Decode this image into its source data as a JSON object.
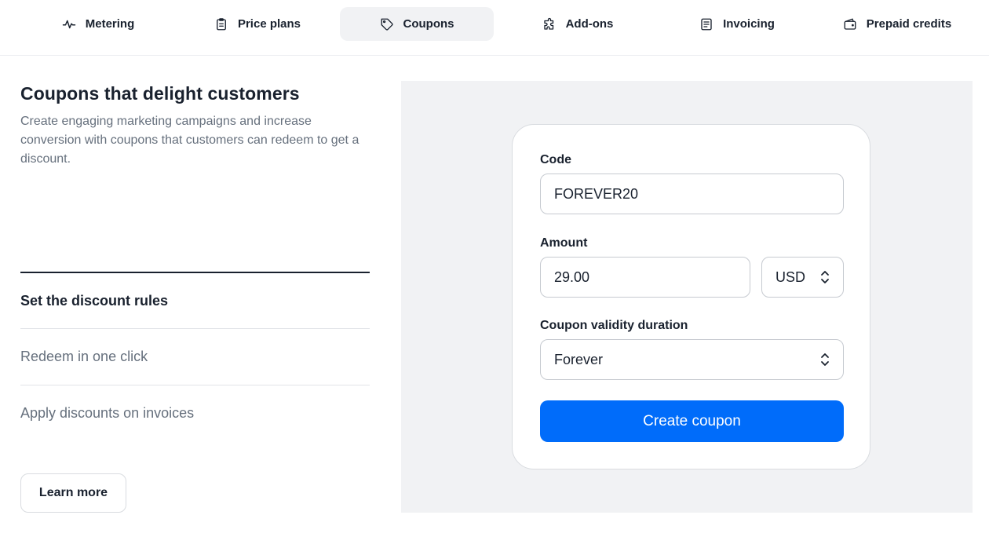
{
  "tabs": [
    {
      "label": "Metering",
      "icon": "pulse-icon",
      "active": false
    },
    {
      "label": "Price plans",
      "icon": "clipboard-icon",
      "active": false
    },
    {
      "label": "Coupons",
      "icon": "tag-icon",
      "active": true
    },
    {
      "label": "Add-ons",
      "icon": "puzzle-icon",
      "active": false
    },
    {
      "label": "Invoicing",
      "icon": "document-icon",
      "active": false
    },
    {
      "label": "Prepaid credits",
      "icon": "wallet-icon",
      "active": false
    }
  ],
  "intro": {
    "title": "Coupons that delight customers",
    "description": "Create engaging marketing campaigns and increase conversion with coupons that customers can redeem to get a discount."
  },
  "features": [
    {
      "label": "Set the discount rules",
      "active": true
    },
    {
      "label": "Redeem in one click",
      "active": false
    },
    {
      "label": "Apply discounts on invoices",
      "active": false
    }
  ],
  "learn_more_label": "Learn more",
  "form": {
    "code_label": "Code",
    "code_value": "FOREVER20",
    "amount_label": "Amount",
    "amount_value": "29.00",
    "currency_value": "USD",
    "duration_label": "Coupon validity duration",
    "duration_value": "Forever",
    "submit_label": "Create coupon"
  },
  "colors": {
    "accent": "#006cfa",
    "text": "#19212e",
    "muted": "#66707d",
    "panel_bg": "#f1f2f4"
  }
}
